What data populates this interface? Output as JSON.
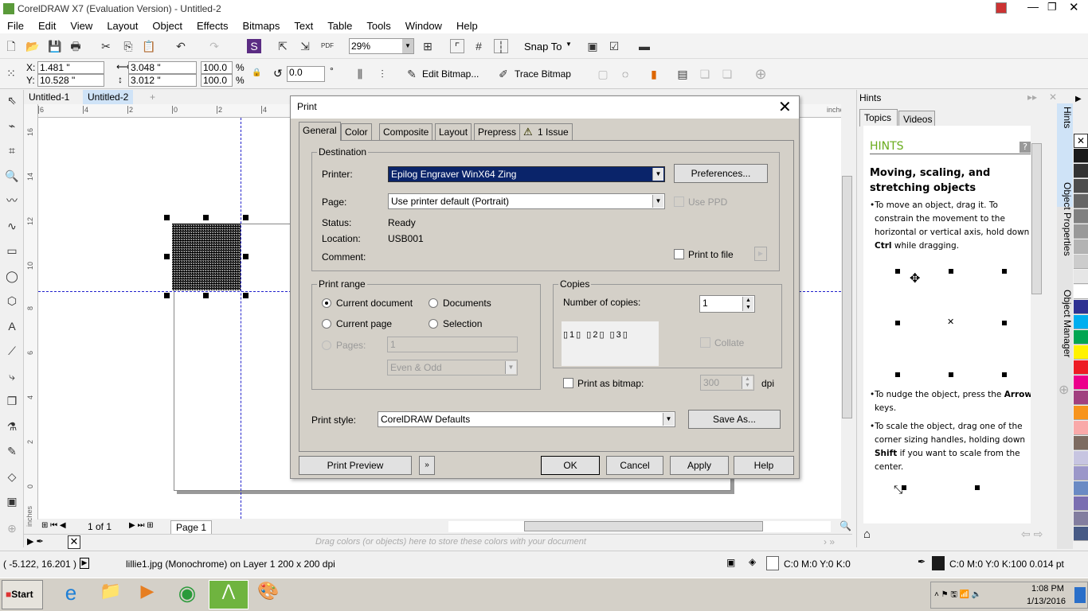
{
  "window": {
    "title": "CorelDRAW X7 (Evaluation Version) - Untitled-2"
  },
  "menu": [
    "File",
    "Edit",
    "View",
    "Layout",
    "Object",
    "Effects",
    "Bitmaps",
    "Text",
    "Table",
    "Tools",
    "Window",
    "Help"
  ],
  "toolbar": {
    "zoom": "29%",
    "snap_to": "Snap To"
  },
  "propbar": {
    "x_label": "X:",
    "x": "1.481 \"",
    "y_label": "Y:",
    "y": "10.528 \"",
    "w": "3.048 \"",
    "h": "3.012 \"",
    "sx": "100.0",
    "sy": "100.0",
    "pct": "%",
    "angle": "0.0",
    "deg": "°",
    "edit_bitmap": "Edit Bitmap...",
    "trace_bitmap": "Trace Bitmap"
  },
  "doc_tabs": [
    "Untitled-1",
    "Untitled-2"
  ],
  "ruler": {
    "units": "inches",
    "top_labels": [
      "6",
      "4",
      "2",
      "0",
      "2",
      "4",
      "6"
    ],
    "left_labels": [
      "16",
      "14",
      "12",
      "10",
      "8",
      "6",
      "4",
      "2",
      "0"
    ]
  },
  "page_nav": {
    "count": "1 of 1",
    "page": "Page 1"
  },
  "color_bar": {
    "hint": "Drag colors (or objects) here to store these colors with your document"
  },
  "status": {
    "coords": "( -5.122, 16.201 )",
    "object": "lillie1.jpg (Monochrome) on Layer 1 200 x 200 dpi",
    "fill": "C:0 M:0 Y:0 K:0",
    "outline": "C:0 M:0 Y:0 K:100  0.014 pt"
  },
  "dialog": {
    "title": "Print",
    "tabs": [
      "General",
      "Color",
      "Composite",
      "Layout",
      "Prepress",
      "1 Issue"
    ],
    "destination": {
      "label": "Destination",
      "printer_label": "Printer:",
      "printer": "Epilog Engraver WinX64 Zing",
      "preferences": "Preferences...",
      "page_label": "Page:",
      "page": "Use printer default (Portrait)",
      "use_ppd": "Use PPD",
      "status_label": "Status:",
      "status": "Ready",
      "location_label": "Location:",
      "location": "USB001",
      "comment_label": "Comment:",
      "print_to_file": "Print to file"
    },
    "range": {
      "label": "Print range",
      "current_document": "Current document",
      "documents": "Documents",
      "current_page": "Current page",
      "selection": "Selection",
      "pages_label": "Pages:",
      "pages": "1",
      "even_odd": "Even & Odd",
      "selected": "Current document"
    },
    "copies": {
      "label": "Copies",
      "number_label": "Number of copies:",
      "number": "1",
      "collate": "Collate"
    },
    "bitmap": {
      "label": "Print as bitmap:",
      "dpi": "300",
      "unit": "dpi"
    },
    "style": {
      "label": "Print style:",
      "value": "CorelDRAW Defaults",
      "save_as": "Save As..."
    },
    "buttons": {
      "preview": "Print Preview",
      "ok": "OK",
      "cancel": "Cancel",
      "apply": "Apply",
      "help": "Help"
    }
  },
  "hints": {
    "panel_title": "Hints",
    "tabs": [
      "Topics",
      "Videos"
    ],
    "heading": "HINTS",
    "title": "Moving, scaling, and stretching objects",
    "b1": [
      "To move an object, drag it. To constrain the movement to the horizontal or vertical axis, hold down ",
      "Ctrl",
      " while dragging."
    ],
    "b2": [
      "To nudge the object, press the ",
      "Arrow",
      " keys."
    ],
    "b3": [
      "To scale the object, drag one of the corner sizing handles, holding down ",
      "Shift",
      " if you want to scale from the center."
    ]
  },
  "docker_tabs": [
    "Hints",
    "Object Properties",
    "Object Manager"
  ],
  "palette": [
    "#1a1a1a",
    "#333333",
    "#4d4d4d",
    "#666666",
    "#808080",
    "#999999",
    "#b3b3b3",
    "#cccccc",
    "#e6e6e6",
    "#ffffff",
    "#2e3192",
    "#00aeef",
    "#00a651",
    "#fff200",
    "#ed1c24",
    "#ec008c",
    "#a1407f",
    "#f7941d",
    "#f9a9a9",
    "#7d6b61",
    "#c7c5e1",
    "#9b97c9",
    "#6a8ac4",
    "#7a6eb1",
    "#827d9f",
    "#475a86"
  ],
  "taskbar": {
    "start": "Start",
    "time": "1:08 PM",
    "date": "1/13/2016"
  }
}
